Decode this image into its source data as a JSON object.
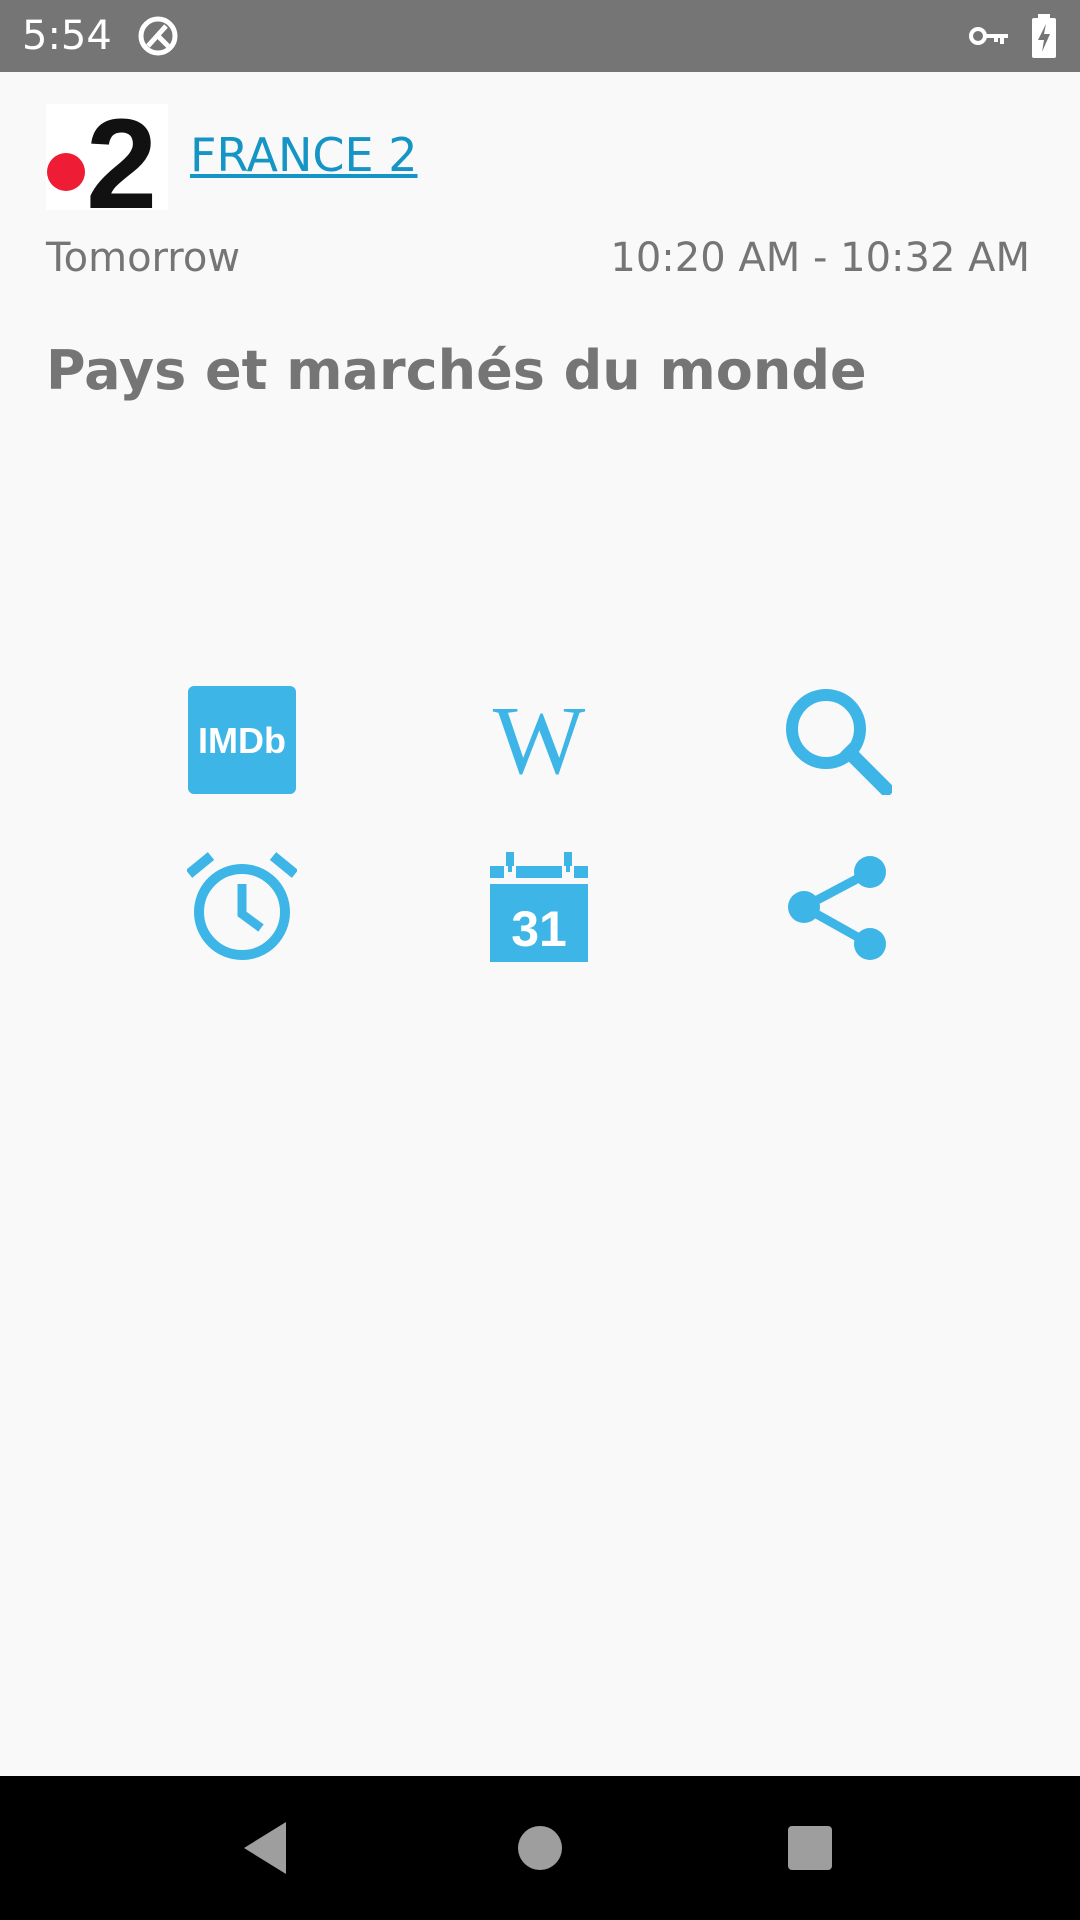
{
  "status_bar": {
    "time": "5:54",
    "icons": [
      "sync-icon",
      "vpn-key-icon",
      "battery-charging-icon"
    ]
  },
  "channel": {
    "logo_text": "2",
    "name": "FRANCE 2"
  },
  "program": {
    "day": "Tomorrow",
    "time_range": "10:20 AM - 10:32 AM",
    "title": "Pays et marchés du monde"
  },
  "actions": {
    "imdb_text": "IMDb",
    "wiki_text": "W",
    "calendar_day": "31",
    "icons": [
      "imdb-icon",
      "wikipedia-icon",
      "search-icon",
      "alarm-icon",
      "calendar-icon",
      "share-icon"
    ]
  },
  "nav": {
    "icons": [
      "back-icon",
      "home-icon",
      "recents-icon"
    ]
  },
  "colors": {
    "accent": "#3db5e6",
    "link": "#1595c5",
    "text_secondary": "#757575",
    "status_bar": "#757575",
    "background": "#f9f9f9"
  }
}
